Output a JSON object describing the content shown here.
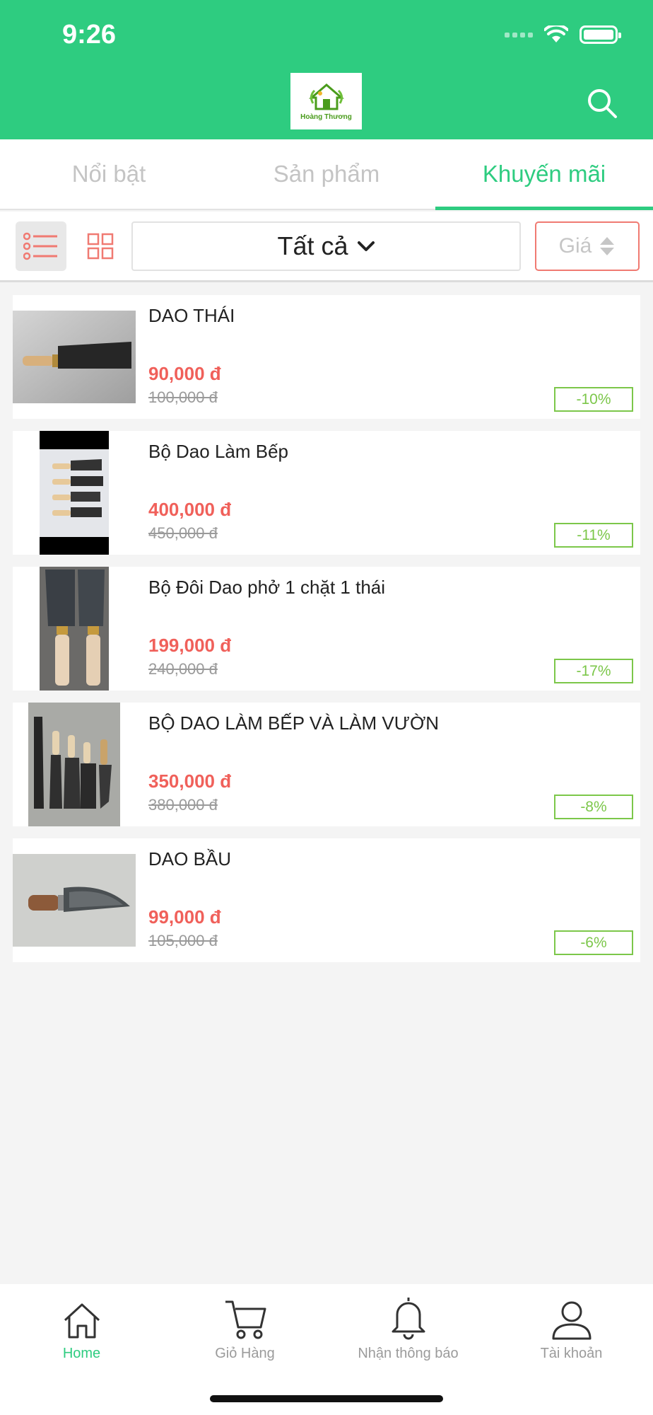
{
  "status": {
    "time": "9:26"
  },
  "brand": {
    "logo_text": "Hoàng Thương"
  },
  "tabs": [
    {
      "label": "Nổi bật",
      "active": false
    },
    {
      "label": "Sản phẩm",
      "active": false
    },
    {
      "label": "Khuyến mãi",
      "active": true
    }
  ],
  "filter": {
    "category": "Tất cả",
    "sort_label": "Giá"
  },
  "products": [
    {
      "name": "DAO THÁI",
      "price": "90,000 đ",
      "old_price": "100,000 đ",
      "discount": "-10%"
    },
    {
      "name": "Bộ Dao Làm Bếp",
      "price": "400,000 đ",
      "old_price": "450,000 đ",
      "discount": "-11%"
    },
    {
      "name": "Bộ Đôi Dao phở 1 chặt 1 thái",
      "price": "199,000 đ",
      "old_price": "240,000 đ",
      "discount": "-17%"
    },
    {
      "name": "BỘ DAO LÀM BẾP VÀ LÀM VƯỜN",
      "price": "350,000 đ",
      "old_price": "380,000 đ",
      "discount": "-8%"
    },
    {
      "name": "DAO BẦU",
      "price": "99,000 đ",
      "old_price": "105,000 đ",
      "discount": "-6%"
    }
  ],
  "bottom_nav": [
    {
      "label": "Home",
      "icon": "home-icon",
      "active": true
    },
    {
      "label": "Giỏ Hàng",
      "icon": "cart-icon",
      "active": false
    },
    {
      "label": "Nhận thông báo",
      "icon": "bell-icon",
      "active": false
    },
    {
      "label": "Tài khoản",
      "icon": "user-icon",
      "active": false
    }
  ],
  "colors": {
    "primary": "#2ecc80",
    "price": "#f0605a",
    "discount": "#7cc74a",
    "sort_border": "#f07a72"
  }
}
